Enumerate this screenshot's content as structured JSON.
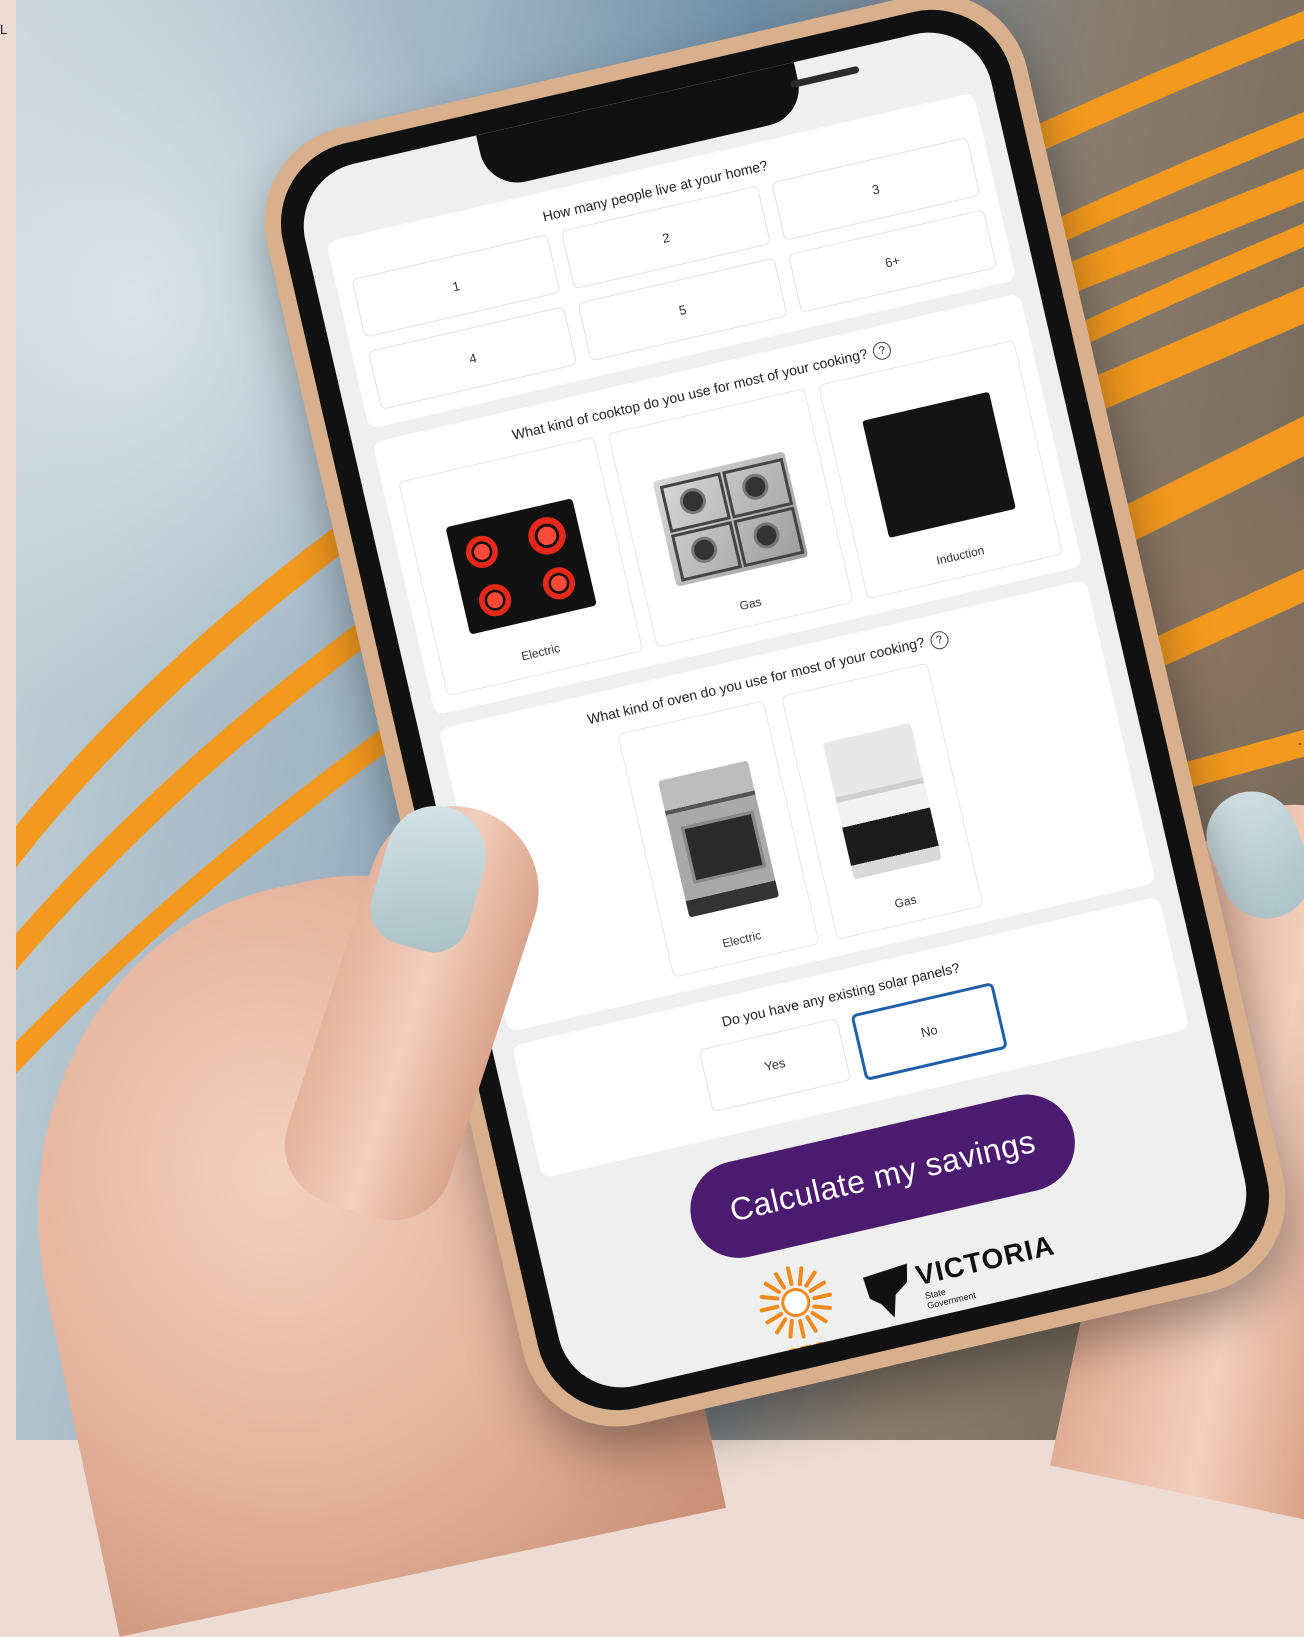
{
  "edge": {
    "left_text": "L",
    "right_tick": "-"
  },
  "household": {
    "question": "How many people live at your home?",
    "options": [
      "1",
      "2",
      "3",
      "4",
      "5",
      "6+"
    ]
  },
  "cooktop": {
    "question": "What kind of cooktop do you use for most of your cooking?",
    "help_glyph": "?",
    "options": [
      "Electric",
      "Gas",
      "Induction"
    ]
  },
  "oven": {
    "question": "What kind of oven do you use for most of your cooking?",
    "help_glyph": "?",
    "options": [
      "Electric",
      "Gas"
    ]
  },
  "solar": {
    "question": "Do you have any existing solar panels?",
    "options": [
      "Yes",
      "No"
    ],
    "selected": "No"
  },
  "cta": {
    "label": "Calculate my savings"
  },
  "logos": {
    "sec": "SEC",
    "victoria": "VICTORIA",
    "victoria_sub": [
      "State",
      "Government"
    ]
  },
  "colors": {
    "cta_bg": "#4a1b6f",
    "selected_border": "#1f5fa8",
    "sec_orange": "#f08a1c",
    "arc_orange": "#f39a1e"
  }
}
